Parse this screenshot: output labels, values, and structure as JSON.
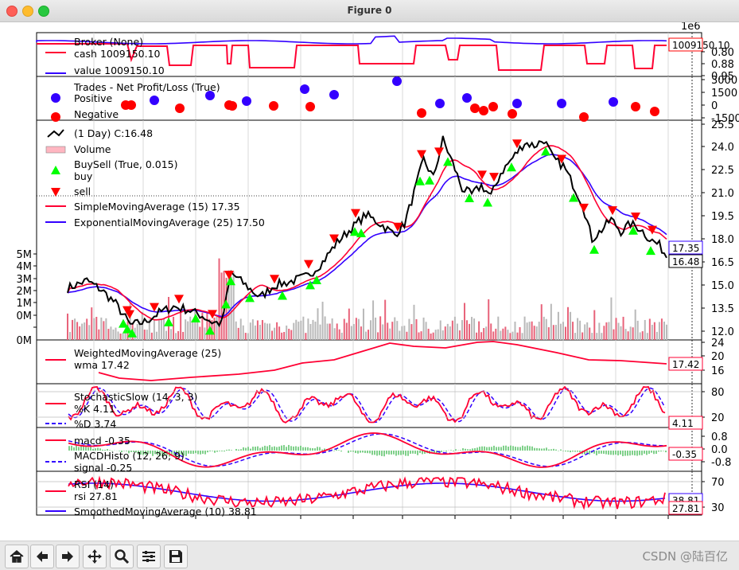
{
  "window": {
    "title": "Figure 0",
    "controls": [
      "close",
      "minimize",
      "zoom"
    ]
  },
  "figure": {
    "exponent_label": "1e6",
    "panels": [
      {
        "id": "broker",
        "legend_title": "Broker (None)",
        "legend": [
          {
            "label": "cash 1009150.10",
            "color": "#ff0033"
          },
          {
            "label": "value 1009150.10",
            "color": "#3300ff"
          }
        ],
        "y_ticks": [
          "0.80",
          "0.88",
          "0.95"
        ],
        "last_value": "1009150.10"
      },
      {
        "id": "trades",
        "legend_title": "Trades - Net Profit/Loss (True)",
        "legend": [
          {
            "label": "Positive",
            "color": "#3300ff"
          },
          {
            "label": "Negative",
            "color": "#ff0000"
          }
        ],
        "y_ticks": [
          "3000",
          "1500",
          "0",
          "-1500"
        ]
      },
      {
        "id": "price",
        "legend": [
          {
            "label": "(1 Day) C:16.48",
            "color": "#000000"
          },
          {
            "label": "Volume",
            "color": "#ffb6c1"
          },
          {
            "label": "BuySell (True, 0.015)",
            "color": null
          },
          {
            "label": "buy",
            "color": "#00ff00"
          },
          {
            "label": "sell",
            "color": "#ff0000"
          },
          {
            "label": "SimpleMovingAverage (15) 17.35",
            "color": "#ff0033"
          },
          {
            "label": "ExponentialMovingAverage (25) 17.50",
            "color": "#3300ff"
          }
        ],
        "y_ticks": [
          "25.5",
          "24.0",
          "22.5",
          "21.0",
          "19.5",
          "18.0",
          "16.5",
          "15.0",
          "13.5",
          "12.0"
        ],
        "volume_ticks": [
          "5M",
          "4M",
          "3M",
          "2M",
          "1M",
          "0M",
          "0M"
        ],
        "last_values": [
          "17.35",
          "16.48"
        ]
      },
      {
        "id": "wma",
        "legend": [
          {
            "label": "WeightedMovingAverage (25)",
            "color": null
          },
          {
            "label": "wma 17.42",
            "color": "#ff0033"
          }
        ],
        "y_ticks": [
          "24",
          "20",
          "16"
        ],
        "last_value": "17.42"
      },
      {
        "id": "stoch",
        "legend": [
          {
            "label": "StochasticSlow (14, 3, 3)",
            "color": null
          },
          {
            "label": "%K 4.11",
            "color": "#ff0033"
          },
          {
            "label": "%D 3.74",
            "color": "#3300ff"
          }
        ],
        "y_ticks": [
          "80",
          "20"
        ],
        "last_value": "4.11"
      },
      {
        "id": "macd",
        "legend": [
          {
            "label": "macd -0.35",
            "color": "#ff0033"
          },
          {
            "label": "MACDHisto (12, 26, 9)",
            "color": null
          },
          {
            "label": "signal -0.25",
            "color": "#3300ff"
          }
        ],
        "y_ticks": [
          "0.8",
          "0.0",
          "-0.8"
        ],
        "last_value": "-0.35"
      },
      {
        "id": "rsi",
        "legend": [
          {
            "label": "RSI (14)",
            "color": null
          },
          {
            "label": "rsi 27.81",
            "color": "#ff0033"
          },
          {
            "label": "SmoothedMovingAverage (10) 38.81",
            "color": "#3300ff"
          }
        ],
        "y_ticks": [
          "70",
          "30"
        ],
        "last_values": [
          "38.81",
          "27.81"
        ]
      }
    ]
  },
  "toolbar": {
    "buttons": [
      "home-icon",
      "back-icon",
      "forward-icon",
      "pan-icon",
      "zoom-icon",
      "configure-icon",
      "save-icon"
    ],
    "watermark": "CSDN @陆百亿"
  },
  "colors": {
    "red": "#ff0033",
    "blue": "#3300ff",
    "black": "#000000",
    "green": "#00ff00",
    "axis": "#000000"
  }
}
